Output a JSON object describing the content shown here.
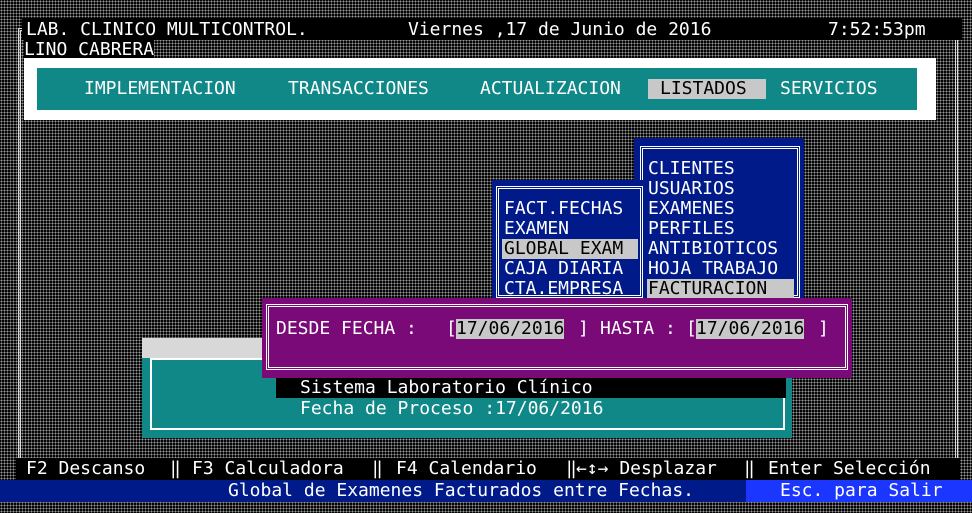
{
  "header": {
    "company": "LAB. CLINICO MULTICONTROL.",
    "date": "Viernes ,17 de Junio de 2016",
    "time": "7:52:53pm",
    "user": "LINO CABRERA"
  },
  "menubar": {
    "items": [
      {
        "label": "IMPLEMENTACION"
      },
      {
        "label": "TRANSACCIONES"
      },
      {
        "label": "ACTUALIZACION"
      },
      {
        "label": "LISTADOS",
        "active": true
      },
      {
        "label": "SERVICIOS"
      }
    ]
  },
  "listados_menu": {
    "items": [
      "CLIENTES",
      "USUARIOS",
      "EXAMENES",
      "PERFILES",
      "ANTIBIOTICOS",
      "HOJA TRABAJO",
      "FACTURACION"
    ],
    "selected": "FACTURACION"
  },
  "facturacion_menu": {
    "items": [
      "FACT.FECHAS",
      "EXAMEN",
      "GLOBAL EXAM",
      "CAJA DIARIA",
      "CTA.EMPRESA"
    ],
    "selected": "GLOBAL EXAM"
  },
  "date_dialog": {
    "desde_label": "DESDE FECHA :",
    "desde_value": "17/06/2016",
    "hasta_label": "HASTA :",
    "hasta_value": "17/06/2016"
  },
  "info_box": {
    "system_name": "Sistema Laboratorio Clínico",
    "process_date": "Fecha de Proceso :17/06/2016"
  },
  "function_keys": {
    "f2": "F2 Descanso",
    "f3": "F3 Calculadora",
    "f4": "F4 Calendario",
    "move": "←↕→ Desplazar",
    "enter": "Enter Selección"
  },
  "status": {
    "message": "Global de Examenes Facturados entre Fechas.",
    "exit": "Esc. para Salir"
  },
  "colors": {
    "teal": "#108888",
    "navy": "#001a8a",
    "purple": "#7a0a78",
    "highlight": "#c8c8c8"
  }
}
